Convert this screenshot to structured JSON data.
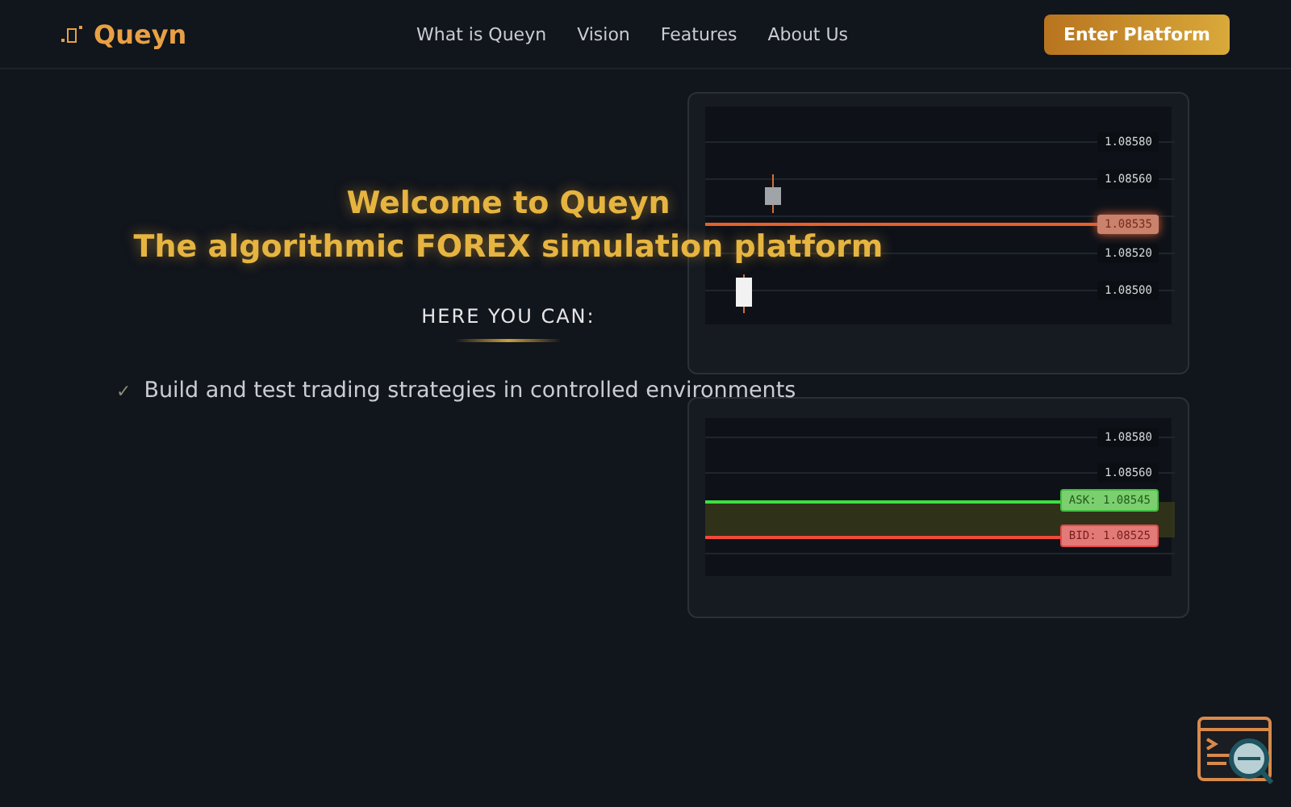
{
  "header": {
    "brand": "Queyn",
    "nav": [
      "What is Queyn",
      "Vision",
      "Features",
      "About Us"
    ],
    "cta": "Enter Platform"
  },
  "hero": {
    "title": "Welcome to Queyn",
    "subtitle": "The algorithmic FOREX simulation platform",
    "section_label": "HERE YOU CAN:",
    "features": [
      {
        "check": "✓",
        "text": "Build and test trading strategies in controlled environments"
      }
    ]
  },
  "charts": [
    {
      "labels": [
        {
          "kind": "level",
          "text": "1.08580"
        },
        {
          "kind": "level",
          "text": "1.08560"
        },
        {
          "kind": "current",
          "text": "1.08535"
        },
        {
          "kind": "level",
          "text": "1.08520"
        },
        {
          "kind": "level",
          "text": "1.08500"
        }
      ]
    },
    {
      "labels": [
        {
          "kind": "level",
          "text": "1.08580"
        },
        {
          "kind": "level",
          "text": "1.08560"
        },
        {
          "kind": "ask",
          "text": "ASK: 1.08545"
        },
        {
          "kind": "bid",
          "text": "BID: 1.08525"
        }
      ]
    }
  ]
}
